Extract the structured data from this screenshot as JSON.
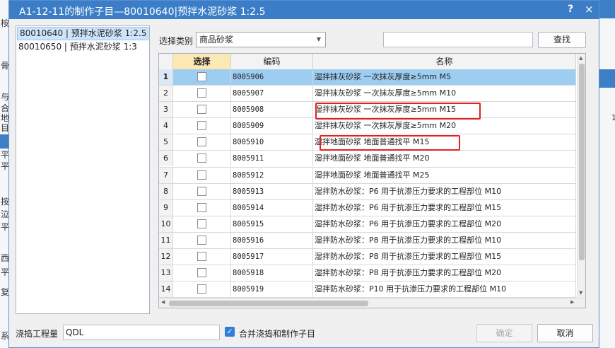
{
  "dialog": {
    "title": "A1-12-11的制作子目—80010640|预拌水泥砂浆 1:2.5",
    "help_label": "?",
    "close_label": "×"
  },
  "left_list": [
    {
      "label": "80010640 | 预拌水泥砂浆 1:2.5",
      "selected": true
    },
    {
      "label": "80010650 | 预拌水泥砂浆 1:3",
      "selected": false
    }
  ],
  "filter": {
    "type_label": "选择类别",
    "type_value": "商品砂浆",
    "search_value": "",
    "find_button": "查找"
  },
  "table": {
    "columns": [
      "",
      "选择",
      "编码",
      "名称"
    ],
    "rows": [
      {
        "num": "1",
        "checked": false,
        "code": "8005906",
        "name": "湿拌抹灰砂浆 一次抹灰厚度≥5mm M5",
        "selected": true
      },
      {
        "num": "2",
        "checked": false,
        "code": "8005907",
        "name": "湿拌抹灰砂浆 一次抹灰厚度≥5mm M10"
      },
      {
        "num": "3",
        "checked": false,
        "code": "8005908",
        "name": "湿拌抹灰砂浆 一次抹灰厚度≥5mm M15",
        "highlight": true
      },
      {
        "num": "4",
        "checked": false,
        "code": "8005909",
        "name": "湿拌抹灰砂浆 一次抹灰厚度≥5mm M20"
      },
      {
        "num": "5",
        "checked": false,
        "code": "8005910",
        "name": "湿拌地面砂浆 地面普通找平 M15",
        "highlight": true
      },
      {
        "num": "6",
        "checked": false,
        "code": "8005911",
        "name": "湿拌地面砂浆 地面普通找平 M20"
      },
      {
        "num": "7",
        "checked": false,
        "code": "8005912",
        "name": "湿拌地面砂浆 地面普通找平 M25"
      },
      {
        "num": "8",
        "checked": false,
        "code": "8005913",
        "name": "湿拌防水砂浆：P6 用于抗渗压力要求的工程部位 M10"
      },
      {
        "num": "9",
        "checked": false,
        "code": "8005914",
        "name": "湿拌防水砂浆：P6 用于抗渗压力要求的工程部位 M15"
      },
      {
        "num": "10",
        "checked": false,
        "code": "8005915",
        "name": "湿拌防水砂浆：P6 用于抗渗压力要求的工程部位 M20"
      },
      {
        "num": "11",
        "checked": false,
        "code": "8005916",
        "name": "湿拌防水砂浆：P8 用于抗渗压力要求的工程部位 M10"
      },
      {
        "num": "12",
        "checked": false,
        "code": "8005917",
        "name": "湿拌防水砂浆：P8 用于抗渗压力要求的工程部位 M15"
      },
      {
        "num": "13",
        "checked": false,
        "code": "8005918",
        "name": "湿拌防水砂浆：P8 用于抗渗压力要求的工程部位 M20"
      },
      {
        "num": "14",
        "checked": false,
        "code": "8005919",
        "name": "湿拌防水砂浆：P10 用于抗渗压力要求的工程部位 M10"
      }
    ]
  },
  "footer": {
    "qty_label": "浇捣工程量",
    "qty_value": "QDL",
    "merge_checked": true,
    "merge_label": "合并浇捣和制作子目",
    "ok_label": "确定",
    "cancel_label": "取消"
  },
  "background": {
    "left_fragments": [
      "桉",
      "骨",
      "与",
      "合",
      "地",
      "目",
      "平",
      "平",
      "按",
      "泣",
      "平",
      "西",
      "平",
      "复",
      "系"
    ],
    "right_number": "1"
  },
  "colors": {
    "titlebar": "#3b7ec7",
    "selected_row": "#9ecdf2",
    "select_header": "#fbe8b4",
    "highlight_box": "#e02222",
    "checkbox_checked": "#2f7fd7"
  }
}
